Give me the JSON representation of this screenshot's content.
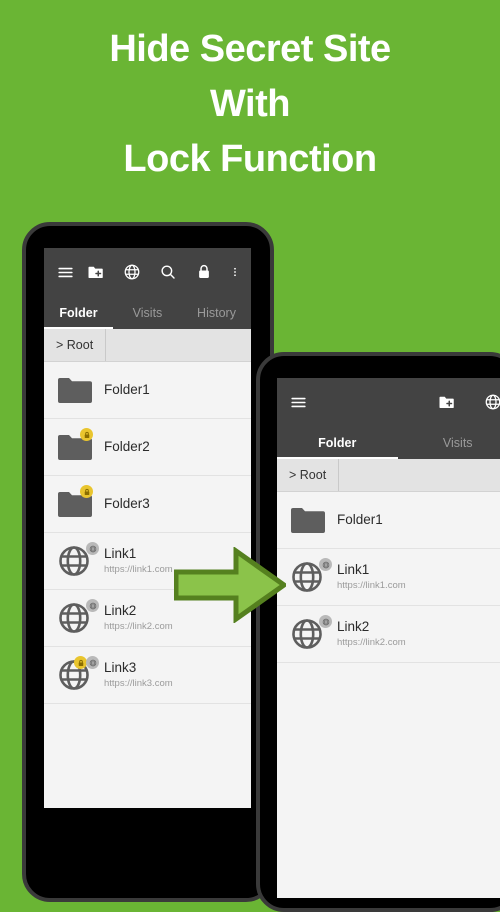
{
  "background_color": "#6ab534",
  "headline": {
    "lines": [
      "Hide Secret Site",
      "With",
      "Lock Function"
    ],
    "color": "#ffffff"
  },
  "phone_left": {
    "appbar": {
      "icons": [
        {
          "name": "hamburger-menu-icon",
          "label": "Menu"
        },
        {
          "name": "folder-add-icon",
          "label": "New folder"
        },
        {
          "name": "globe-icon",
          "label": "New link"
        },
        {
          "name": "search-icon",
          "label": "Search"
        },
        {
          "name": "lock-icon",
          "label": "Lock"
        },
        {
          "name": "overflow-menu-icon",
          "label": "More options"
        }
      ]
    },
    "tabs": [
      {
        "label": "Folder",
        "active": true
      },
      {
        "label": "Visits",
        "active": false
      },
      {
        "label": "History",
        "active": false
      }
    ],
    "breadcrumb": "> Root",
    "rows": [
      {
        "type": "folder",
        "title": "Folder1",
        "url": "",
        "locked": false,
        "web_badge": false
      },
      {
        "type": "folder",
        "title": "Folder2",
        "url": "",
        "locked": true,
        "web_badge": false
      },
      {
        "type": "folder",
        "title": "Folder3",
        "url": "",
        "locked": true,
        "web_badge": false
      },
      {
        "type": "link",
        "title": "Link1",
        "url": "https://link1.com",
        "locked": false,
        "web_badge": true
      },
      {
        "type": "link",
        "title": "Link2",
        "url": "https://link2.com",
        "locked": false,
        "web_badge": true
      },
      {
        "type": "link",
        "title": "Link3",
        "url": "https://link3.com",
        "locked": true,
        "web_badge": true
      }
    ]
  },
  "phone_right": {
    "appbar": {
      "icons": [
        {
          "name": "hamburger-menu-icon",
          "label": "Menu"
        },
        {
          "name": "folder-add-icon",
          "label": "New folder"
        },
        {
          "name": "globe-icon",
          "label": "New link"
        }
      ]
    },
    "tabs": [
      {
        "label": "Folder",
        "active": true
      },
      {
        "label": "Visits",
        "active": false
      }
    ],
    "breadcrumb": "> Root",
    "rows": [
      {
        "type": "folder",
        "title": "Folder1",
        "url": "",
        "locked": false,
        "web_badge": false
      },
      {
        "type": "link",
        "title": "Link1",
        "url": "https://link1.com",
        "locked": false,
        "web_badge": true
      },
      {
        "type": "link",
        "title": "Link2",
        "url": "https://link2.com",
        "locked": false,
        "web_badge": true
      }
    ]
  },
  "arrow": {
    "name": "right-arrow",
    "fill": "#8bc34a",
    "stroke": "#55801f"
  }
}
